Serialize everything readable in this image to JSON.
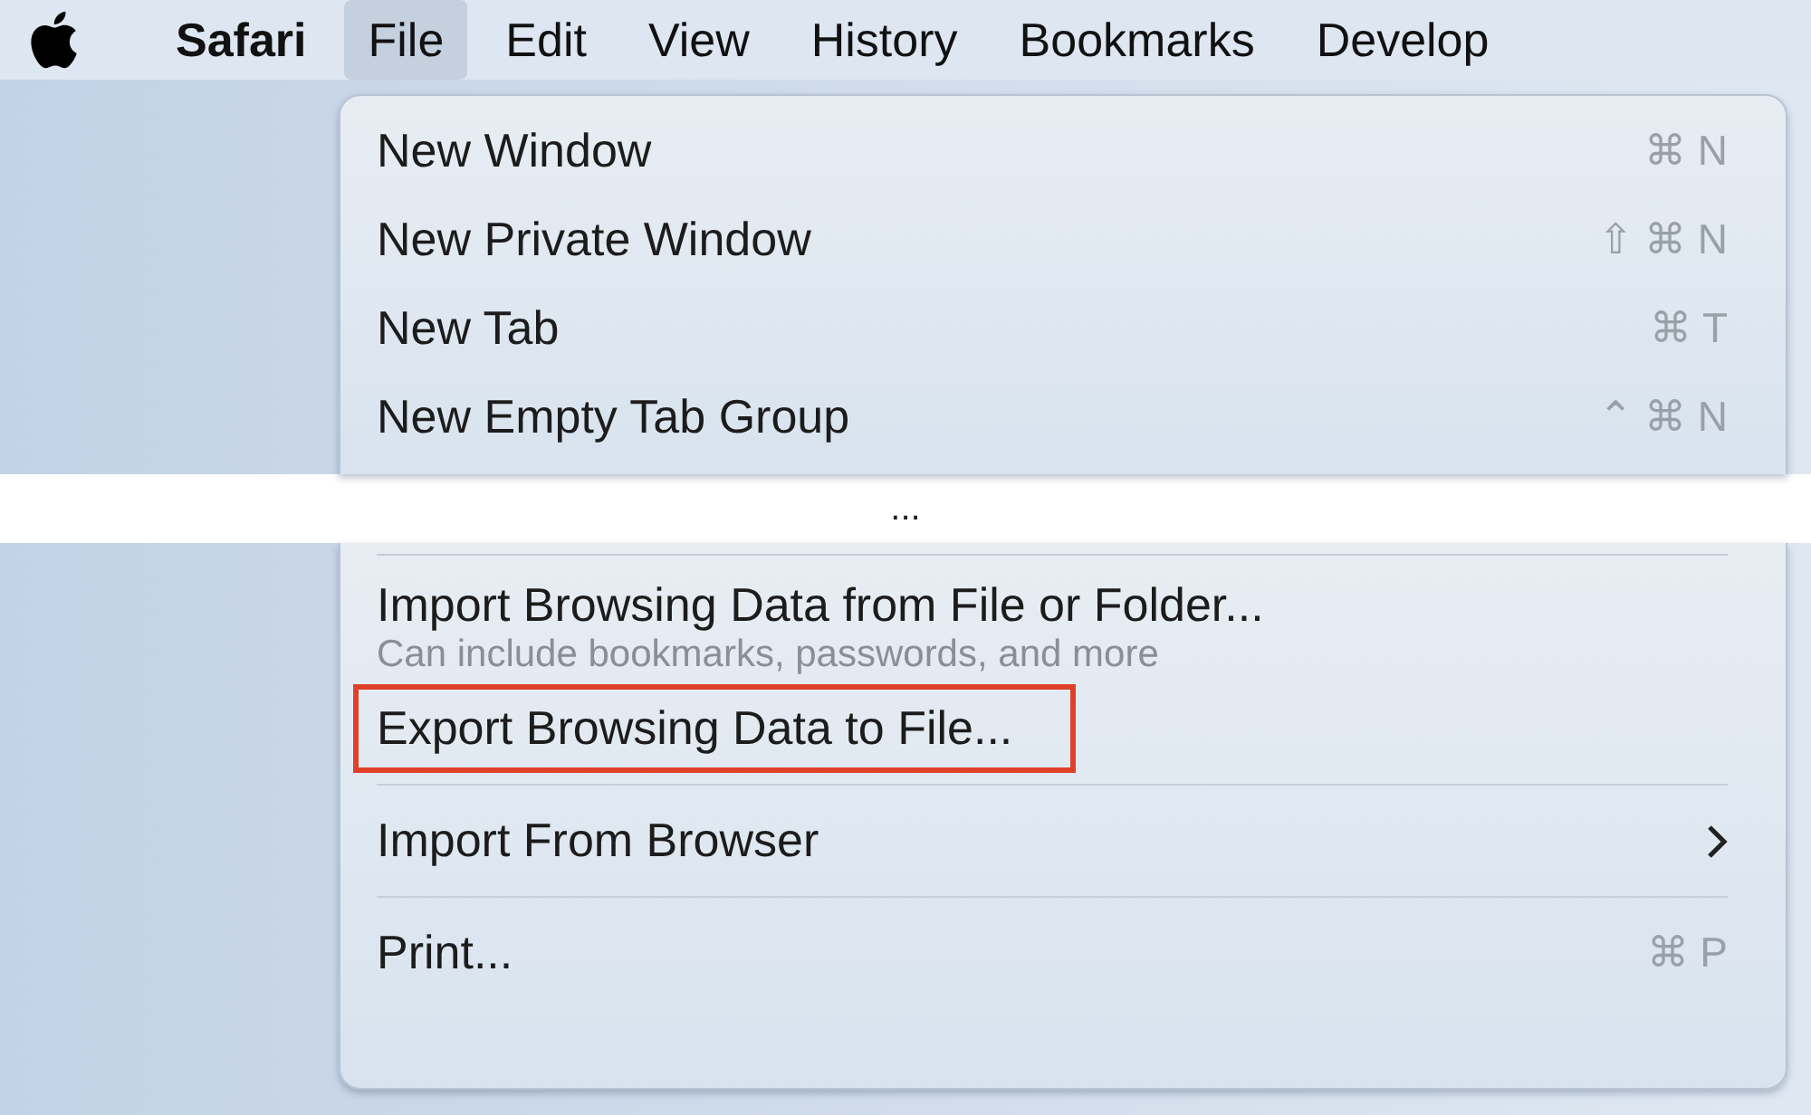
{
  "menu_bar": [
    {
      "label": "Safari",
      "kind": "app",
      "selected": false
    },
    {
      "label": "File",
      "kind": "menu",
      "selected": true
    },
    {
      "label": "Edit",
      "kind": "menu",
      "selected": false
    },
    {
      "label": "View",
      "kind": "menu",
      "selected": false
    },
    {
      "label": "History",
      "kind": "menu",
      "selected": false
    },
    {
      "label": "Bookmarks",
      "kind": "menu",
      "selected": false
    },
    {
      "label": "Develop",
      "kind": "menu",
      "selected": false
    }
  ],
  "menu_top": [
    {
      "kind": "item",
      "label": "New Window",
      "shortcut": "⌘ N"
    },
    {
      "kind": "item",
      "label": "New Private Window",
      "shortcut": "⇧ ⌘ N"
    },
    {
      "kind": "item",
      "label": "New Tab",
      "shortcut": "⌘ T"
    },
    {
      "kind": "item",
      "label": "New Empty Tab Group",
      "shortcut": "⌃ ⌘ N"
    }
  ],
  "omission": "...",
  "menu_bottom": [
    {
      "kind": "separator"
    },
    {
      "kind": "item",
      "label": "Import Browsing Data from File or Folder...",
      "subtitle": "Can include bookmarks, passwords, and more"
    },
    {
      "kind": "item",
      "label": "Export Browsing Data to File...",
      "annotated": true
    },
    {
      "kind": "separator"
    },
    {
      "kind": "submenu",
      "label": "Import From Browser"
    },
    {
      "kind": "separator"
    },
    {
      "kind": "item",
      "label": "Print...",
      "shortcut": "⌘ P"
    }
  ]
}
